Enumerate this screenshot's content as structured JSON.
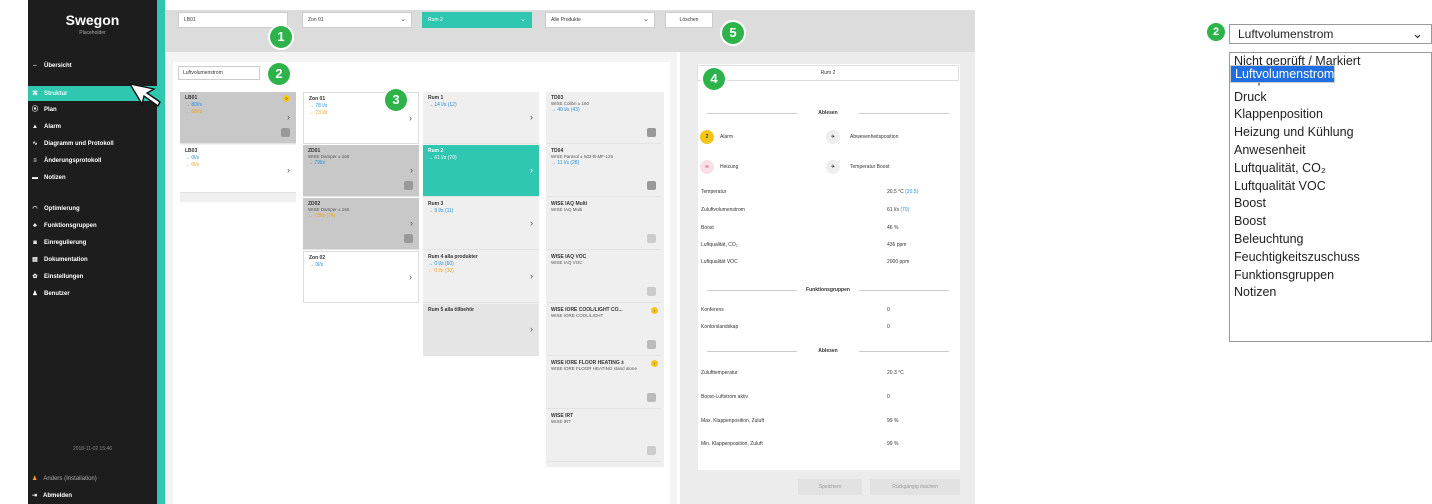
{
  "sidebar": {
    "logo": "Swegon",
    "logo_sub": "Placeholder",
    "items": [
      {
        "label": "Übersicht",
        "icon": "eye-icon",
        "glyph": "⇔"
      },
      {
        "label": "Struktur",
        "icon": "structure-icon",
        "glyph": "⌘"
      },
      {
        "label": "Plan",
        "icon": "pin-icon",
        "glyph": "⦿"
      },
      {
        "label": "Alarm",
        "icon": "bell-icon",
        "glyph": "▲"
      },
      {
        "label": "Diagramm und Protokoll",
        "icon": "chart-icon",
        "glyph": "∿"
      },
      {
        "label": "Änderungsprotokoll",
        "icon": "list-icon",
        "glyph": "≡"
      },
      {
        "label": "Notizen",
        "icon": "note-icon",
        "glyph": "▬"
      },
      {
        "label": "Optimierung",
        "icon": "gauge-icon",
        "glyph": "◠"
      },
      {
        "label": "Funktionsgruppen",
        "icon": "group-icon",
        "glyph": "♣"
      },
      {
        "label": "Einregulierung",
        "icon": "adjust-icon",
        "glyph": "◙"
      },
      {
        "label": "Dokumentation",
        "icon": "doc-icon",
        "glyph": "▤"
      },
      {
        "label": "Einstellungen",
        "icon": "gear-icon",
        "glyph": "✿"
      },
      {
        "label": "Benutzer",
        "icon": "users-icon",
        "glyph": "♟"
      }
    ],
    "date": "2018-11-02 15:46",
    "user": "Anders (Installation)",
    "logout": "Abmelden"
  },
  "filters": {
    "building": "LB01",
    "zone": "Zon 01",
    "room": "Rum 2",
    "products": "Alle Produkte",
    "clear": "Löschen"
  },
  "view_select": "Luftvolumenstrom",
  "columns": {
    "lb": [
      {
        "title": "LB01",
        "rows": [
          "→ 80l/s",
          "← 68l/s"
        ]
      },
      {
        "title": "LB03",
        "rows": [
          "→ 0l/s",
          "← 0l/s"
        ]
      }
    ],
    "zon": [
      {
        "title": "Zon 01",
        "rows": [
          "→ 78 l/s",
          "← 73 l/s"
        ]
      },
      {
        "title": "ZD01",
        "sub": "WISE Damper ± 160",
        "rows": [
          "→ 79l/s"
        ]
      },
      {
        "title": "ZD02",
        "sub": "WISE Damper ± 160",
        "rows": [
          "← 73l/s (74)"
        ]
      },
      {
        "title": "Zon 02",
        "rows": [
          "→ 0l/s"
        ]
      }
    ],
    "rum": [
      {
        "title": "Rum 1",
        "rows": [
          "→ 14 l/s (12)"
        ]
      },
      {
        "title": "Rum 2",
        "rows": [
          "→ 61 l/s (70)"
        ]
      },
      {
        "title": "Rum 3",
        "rows": [
          "→ 9 l/s (11)"
        ]
      },
      {
        "title": "Rum 4 alla produkter",
        "rows": [
          "→ 0 l/s (60)",
          "← 0 l/s (30)"
        ]
      },
      {
        "title": "Rum 5 alla tillbehör",
        "rows": []
      }
    ],
    "prod": [
      {
        "title": "TD03",
        "sub": "WISE Colibri ± 160",
        "rows": [
          "→ 40 l/s (43)"
        ]
      },
      {
        "title": "TD04",
        "sub": "WISE Parasol ± 502-B-MF-125",
        "rows": [
          "→ 11 l/s (28)"
        ]
      },
      {
        "title": "WISE IAQ Multi",
        "sub": "WISE IAQ Multi",
        "rows": []
      },
      {
        "title": "WISE IAQ VOC",
        "sub": "WISE IAQ VOC",
        "rows": []
      },
      {
        "title": "WISE IORE COOL/LIGHT CO...",
        "sub": "WISE IORE COOL/LIGHT",
        "rows": []
      },
      {
        "title": "WISE IORE FLOOR HEATING ±",
        "sub": "WISE IORE FLOOR HEATING stand alone",
        "rows": []
      },
      {
        "title": "WISE IRT",
        "sub": "WISE IRT",
        "rows": []
      }
    ]
  },
  "detail": {
    "room": "Rum 2",
    "sec1": "Ablesen",
    "alarm_count": "2",
    "alarm": "Alarm",
    "abwesend": "Abwesenheitsposition",
    "heizung": "Heizung",
    "temp_boost": "Temperatur Boost",
    "kv1": [
      {
        "k": "Temperatur",
        "v": "20.5  °C",
        "v2": "(20.5)"
      },
      {
        "k": "Zuluftvolumenstrom",
        "v": "61  l/s",
        "v2": "(70)"
      },
      {
        "k": "Boost",
        "v": "46  %",
        "v2": ""
      },
      {
        "k": "Luftqualität, CO₂",
        "v": "436  ppm",
        "v2": ""
      },
      {
        "k": "Luftqualität VOC",
        "v": "2000  ppm",
        "v2": ""
      }
    ],
    "sec2": "Funktionsgruppen",
    "kv2": [
      {
        "k": "Konferens",
        "v": "0"
      },
      {
        "k": "Kontorslandskap",
        "v": "0"
      }
    ],
    "sec3": "Ablesen",
    "kv3": [
      {
        "k": "Zulufttemperatur",
        "v": "20.3  °C"
      },
      {
        "k": "Boost-Luftstrom aktiv",
        "v": "0"
      },
      {
        "k": "Max. Klappenposition, Zuluft",
        "v": "99  %"
      },
      {
        "k": "Min. Klappenposition, Zuluft",
        "v": "99  %"
      }
    ],
    "save": "Speichern",
    "undo": "Rückgängig machen"
  },
  "callouts": [
    "1",
    "2",
    "3",
    "4",
    "5",
    "2"
  ],
  "right_dropdown": {
    "selected": "Luftvolumenstrom",
    "options": [
      "Luftvolumenstrom",
      "Nicht geprüft / Markiert",
      "Temperatur",
      "Druck",
      "Klappenposition",
      "Heizung und Kühlung",
      "Anwesenheit",
      "Luftqualität, CO₂",
      "Luftqualität VOC",
      "Boost",
      "Boost",
      "Beleuchtung",
      "Feuchtigkeitszuschuss",
      "Funktionsgruppen",
      "Notizen"
    ]
  },
  "colors": {
    "accent": "#2fc7b0",
    "callout": "#2db34a",
    "sidebar": "#1d1d1d",
    "select": "#1f6fe0"
  }
}
